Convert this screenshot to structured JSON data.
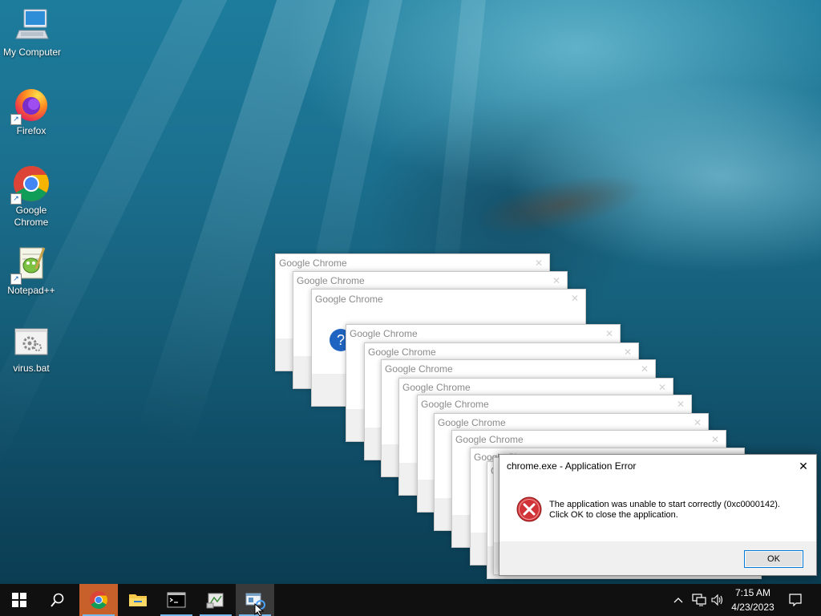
{
  "desktop": {
    "icons": [
      {
        "label": "My Computer",
        "icon": "computer-icon"
      },
      {
        "label": "Firefox",
        "icon": "firefox-icon"
      },
      {
        "label": "Google Chrome",
        "icon": "chrome-icon"
      },
      {
        "label": "Notepad++",
        "icon": "notepadpp-icon"
      },
      {
        "label": "virus.bat",
        "icon": "batch-file-icon"
      }
    ]
  },
  "stacked_dialogs": {
    "title": "Google Chrome",
    "count": 13
  },
  "error_dialog": {
    "title": "chrome.exe - Application Error",
    "message_line1": "The application was unable to start correctly (0xc0000142).",
    "message_line2": "Click OK to close the application.",
    "ok_label": "OK",
    "icon": "error-icon"
  },
  "taskbar": {
    "items": [
      "start-icon",
      "search-icon",
      "chrome-icon",
      "file-explorer-icon",
      "terminal-icon",
      "app-icon",
      "window-app-icon"
    ],
    "tray": [
      "chevron-up-icon",
      "network-icon",
      "volume-icon"
    ],
    "time": "7:15 AM",
    "date": "4/23/2023",
    "notification_icon": "notification-icon"
  },
  "colors": {
    "accent": "#0078d7",
    "error_red": "#d13438",
    "taskbar": "#101010"
  }
}
